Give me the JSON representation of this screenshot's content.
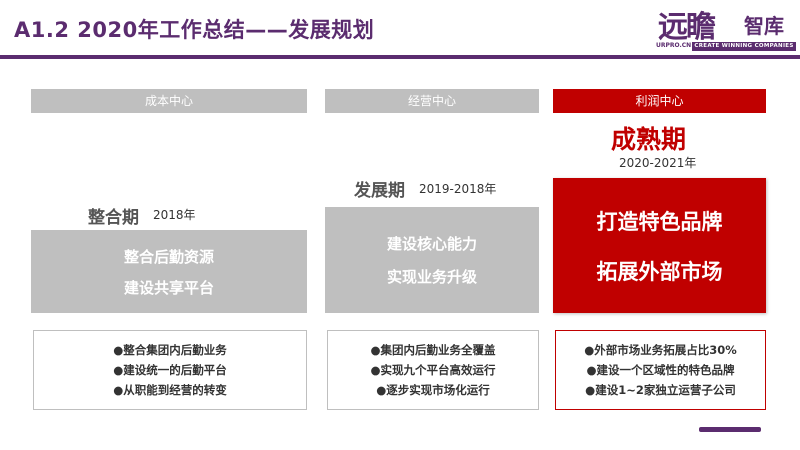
{
  "header": {
    "title": "A1.2  2020年工作总结——发展规划",
    "brand_color": "#5b2c6f"
  },
  "logo": {
    "calligraphy": "远瞻",
    "name": "智库",
    "url": "URPRO.CN",
    "tagline": "CREATE WINNING COMPANIES"
  },
  "columns": [
    {
      "header": "成本中心",
      "stage": "整合期",
      "year": "2018年",
      "box_lines": [
        "整合后勤资源",
        "建设共享平台"
      ],
      "details": [
        "●整合集团内后勤业务",
        "●建设统一的后勤平台",
        "●从职能到经营的转变"
      ],
      "color": "#bfbfbf"
    },
    {
      "header": "经营中心",
      "stage": "发展期",
      "year": "2019-2018年",
      "box_lines": [
        "建设核心能力",
        "实现业务升级"
      ],
      "details": [
        "●集团内后勤业务全覆盖",
        "●实现九个平台高效运行",
        "●逐步实现市场化运行"
      ],
      "color": "#bfbfbf"
    },
    {
      "header": "利润中心",
      "stage": "成熟期",
      "year": "2020-2021年",
      "box_lines": [
        "打造特色品牌",
        "拓展外部市场"
      ],
      "details": [
        "●外部市场业务拓展占比30%",
        "●建设一个区域性的特色品牌",
        "●建设1~2家独立运营子公司"
      ],
      "color": "#c00000"
    }
  ]
}
